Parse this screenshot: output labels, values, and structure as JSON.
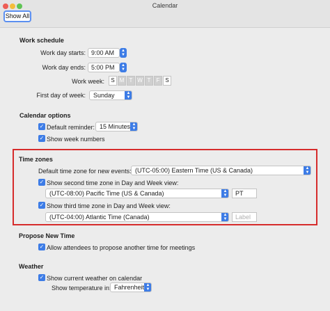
{
  "window": {
    "title": "Calendar",
    "show_all": "Show All"
  },
  "work_schedule": {
    "title": "Work schedule",
    "day_starts_label": "Work day starts:",
    "day_starts_value": "9:00 AM",
    "day_ends_label": "Work day ends:",
    "day_ends_value": "5:00 PM",
    "work_week_label": "Work week:",
    "days": [
      "S",
      "M",
      "T",
      "W",
      "T",
      "F",
      "S"
    ],
    "first_day_label": "First day of week:",
    "first_day_value": "Sunday"
  },
  "calendar_options": {
    "title": "Calendar options",
    "default_reminder_label": "Default reminder:",
    "default_reminder_value": "15 Minutes",
    "show_week_numbers_label": "Show week numbers"
  },
  "time_zones": {
    "title": "Time zones",
    "default_label": "Default time zone for new events:",
    "default_value": "(UTC-05:00) Eastern Time (US & Canada)",
    "second_label": "Show second time zone in Day and Week view:",
    "second_value": "(UTC-08:00) Pacific Time (US & Canada)",
    "second_tag": "PT",
    "third_label": "Show third time zone in Day and Week view:",
    "third_value": "(UTC-04:00) Atlantic Time (Canada)",
    "third_placeholder": "Label"
  },
  "propose_new_time": {
    "title": "Propose New Time",
    "allow_label": "Allow attendees to propose another time for meetings"
  },
  "weather": {
    "title": "Weather",
    "show_weather_label": "Show current weather on calendar",
    "temperature_label": "Show temperature in:",
    "temperature_value": "Fahrenheit"
  },
  "colors": {
    "accent": "#3d7ce6",
    "highlight_box": "#d62b2b"
  }
}
